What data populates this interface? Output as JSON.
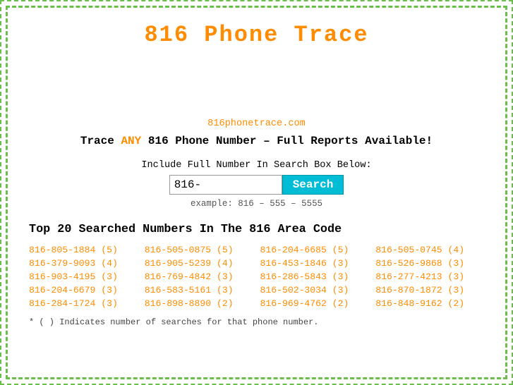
{
  "title": "816 Phone Trace",
  "site_name": "816phonetrace.com",
  "tagline_prefix": "Trace ",
  "tagline_any": "ANY",
  "tagline_suffix": " 816 Phone Number – Full Reports Available!",
  "search": {
    "label": "Include Full Number In Search Box Below:",
    "input_value": "816-",
    "button_label": "Search",
    "example": "example: 816 – 555 – 5555"
  },
  "top_numbers_title": "Top 20 Searched Numbers In The 816 Area Code",
  "numbers": [
    {
      "text": "816-805-1884 (5)",
      "col": 0
    },
    {
      "text": "816-505-0875 (5)",
      "col": 1
    },
    {
      "text": "816-204-6685 (5)",
      "col": 2
    },
    {
      "text": "816-505-0745 (4)",
      "col": 3
    },
    {
      "text": "816-379-9093 (4)",
      "col": 0
    },
    {
      "text": "816-905-5239 (4)",
      "col": 1
    },
    {
      "text": "816-453-1846 (3)",
      "col": 2
    },
    {
      "text": "816-526-9868 (3)",
      "col": 3
    },
    {
      "text": "816-903-4195 (3)",
      "col": 0
    },
    {
      "text": "816-769-4842 (3)",
      "col": 1
    },
    {
      "text": "816-286-5843 (3)",
      "col": 2
    },
    {
      "text": "816-277-4213 (3)",
      "col": 3
    },
    {
      "text": "816-204-6679 (3)",
      "col": 0
    },
    {
      "text": "816-583-5161 (3)",
      "col": 1
    },
    {
      "text": "816-502-3034 (3)",
      "col": 2
    },
    {
      "text": "816-870-1872 (3)",
      "col": 3
    },
    {
      "text": "816-284-1724 (3)",
      "col": 0
    },
    {
      "text": "816-898-8890 (2)",
      "col": 1
    },
    {
      "text": "816-969-4762 (2)",
      "col": 2
    },
    {
      "text": "816-848-9162 (2)",
      "col": 3
    }
  ],
  "footnote": "* ( ) Indicates number of searches for that phone number."
}
